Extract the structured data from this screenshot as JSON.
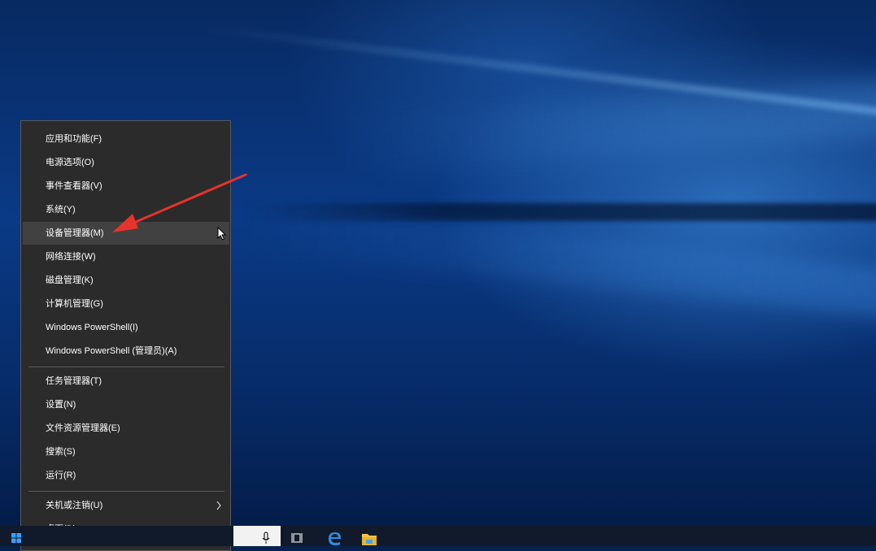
{
  "desktop": {
    "context_menu": {
      "group1": [
        {
          "label": "应用和功能(F)",
          "name": "menu-item-apps-features"
        },
        {
          "label": "电源选项(O)",
          "name": "menu-item-power-options"
        },
        {
          "label": "事件查看器(V)",
          "name": "menu-item-event-viewer"
        },
        {
          "label": "系统(Y)",
          "name": "menu-item-system"
        },
        {
          "label": "设备管理器(M)",
          "name": "menu-item-device-manager"
        },
        {
          "label": "网络连接(W)",
          "name": "menu-item-network-connections"
        },
        {
          "label": "磁盘管理(K)",
          "name": "menu-item-disk-management"
        },
        {
          "label": "计算机管理(G)",
          "name": "menu-item-computer-management"
        },
        {
          "label": "Windows PowerShell(I)",
          "name": "menu-item-powershell"
        },
        {
          "label": "Windows PowerShell (管理员)(A)",
          "name": "menu-item-powershell-admin"
        }
      ],
      "group2": [
        {
          "label": "任务管理器(T)",
          "name": "menu-item-task-manager"
        },
        {
          "label": "设置(N)",
          "name": "menu-item-settings"
        },
        {
          "label": "文件资源管理器(E)",
          "name": "menu-item-file-explorer"
        },
        {
          "label": "搜索(S)",
          "name": "menu-item-search"
        },
        {
          "label": "运行(R)",
          "name": "menu-item-run"
        }
      ],
      "group3": [
        {
          "label": "关机或注销(U)",
          "name": "menu-item-shutdown-signout"
        },
        {
          "label": "桌面(D)",
          "name": "menu-item-desktop"
        }
      ],
      "highlighted_item": "设备管理器(M)"
    },
    "annotation": {
      "arrow_color": "#e8322c",
      "icon": "red-arrow-annotation"
    }
  },
  "taskbar": {
    "icons": [
      "windows-start-icon",
      "microphone-icon",
      "task-view-icon",
      "edge-browser-icon",
      "file-explorer-icon"
    ]
  },
  "colors": {
    "menu_bg": "#2b2b2b",
    "menu_highlight": "#414141",
    "menu_text": "#ffffff",
    "desktop_accent": "#0a3a86"
  }
}
